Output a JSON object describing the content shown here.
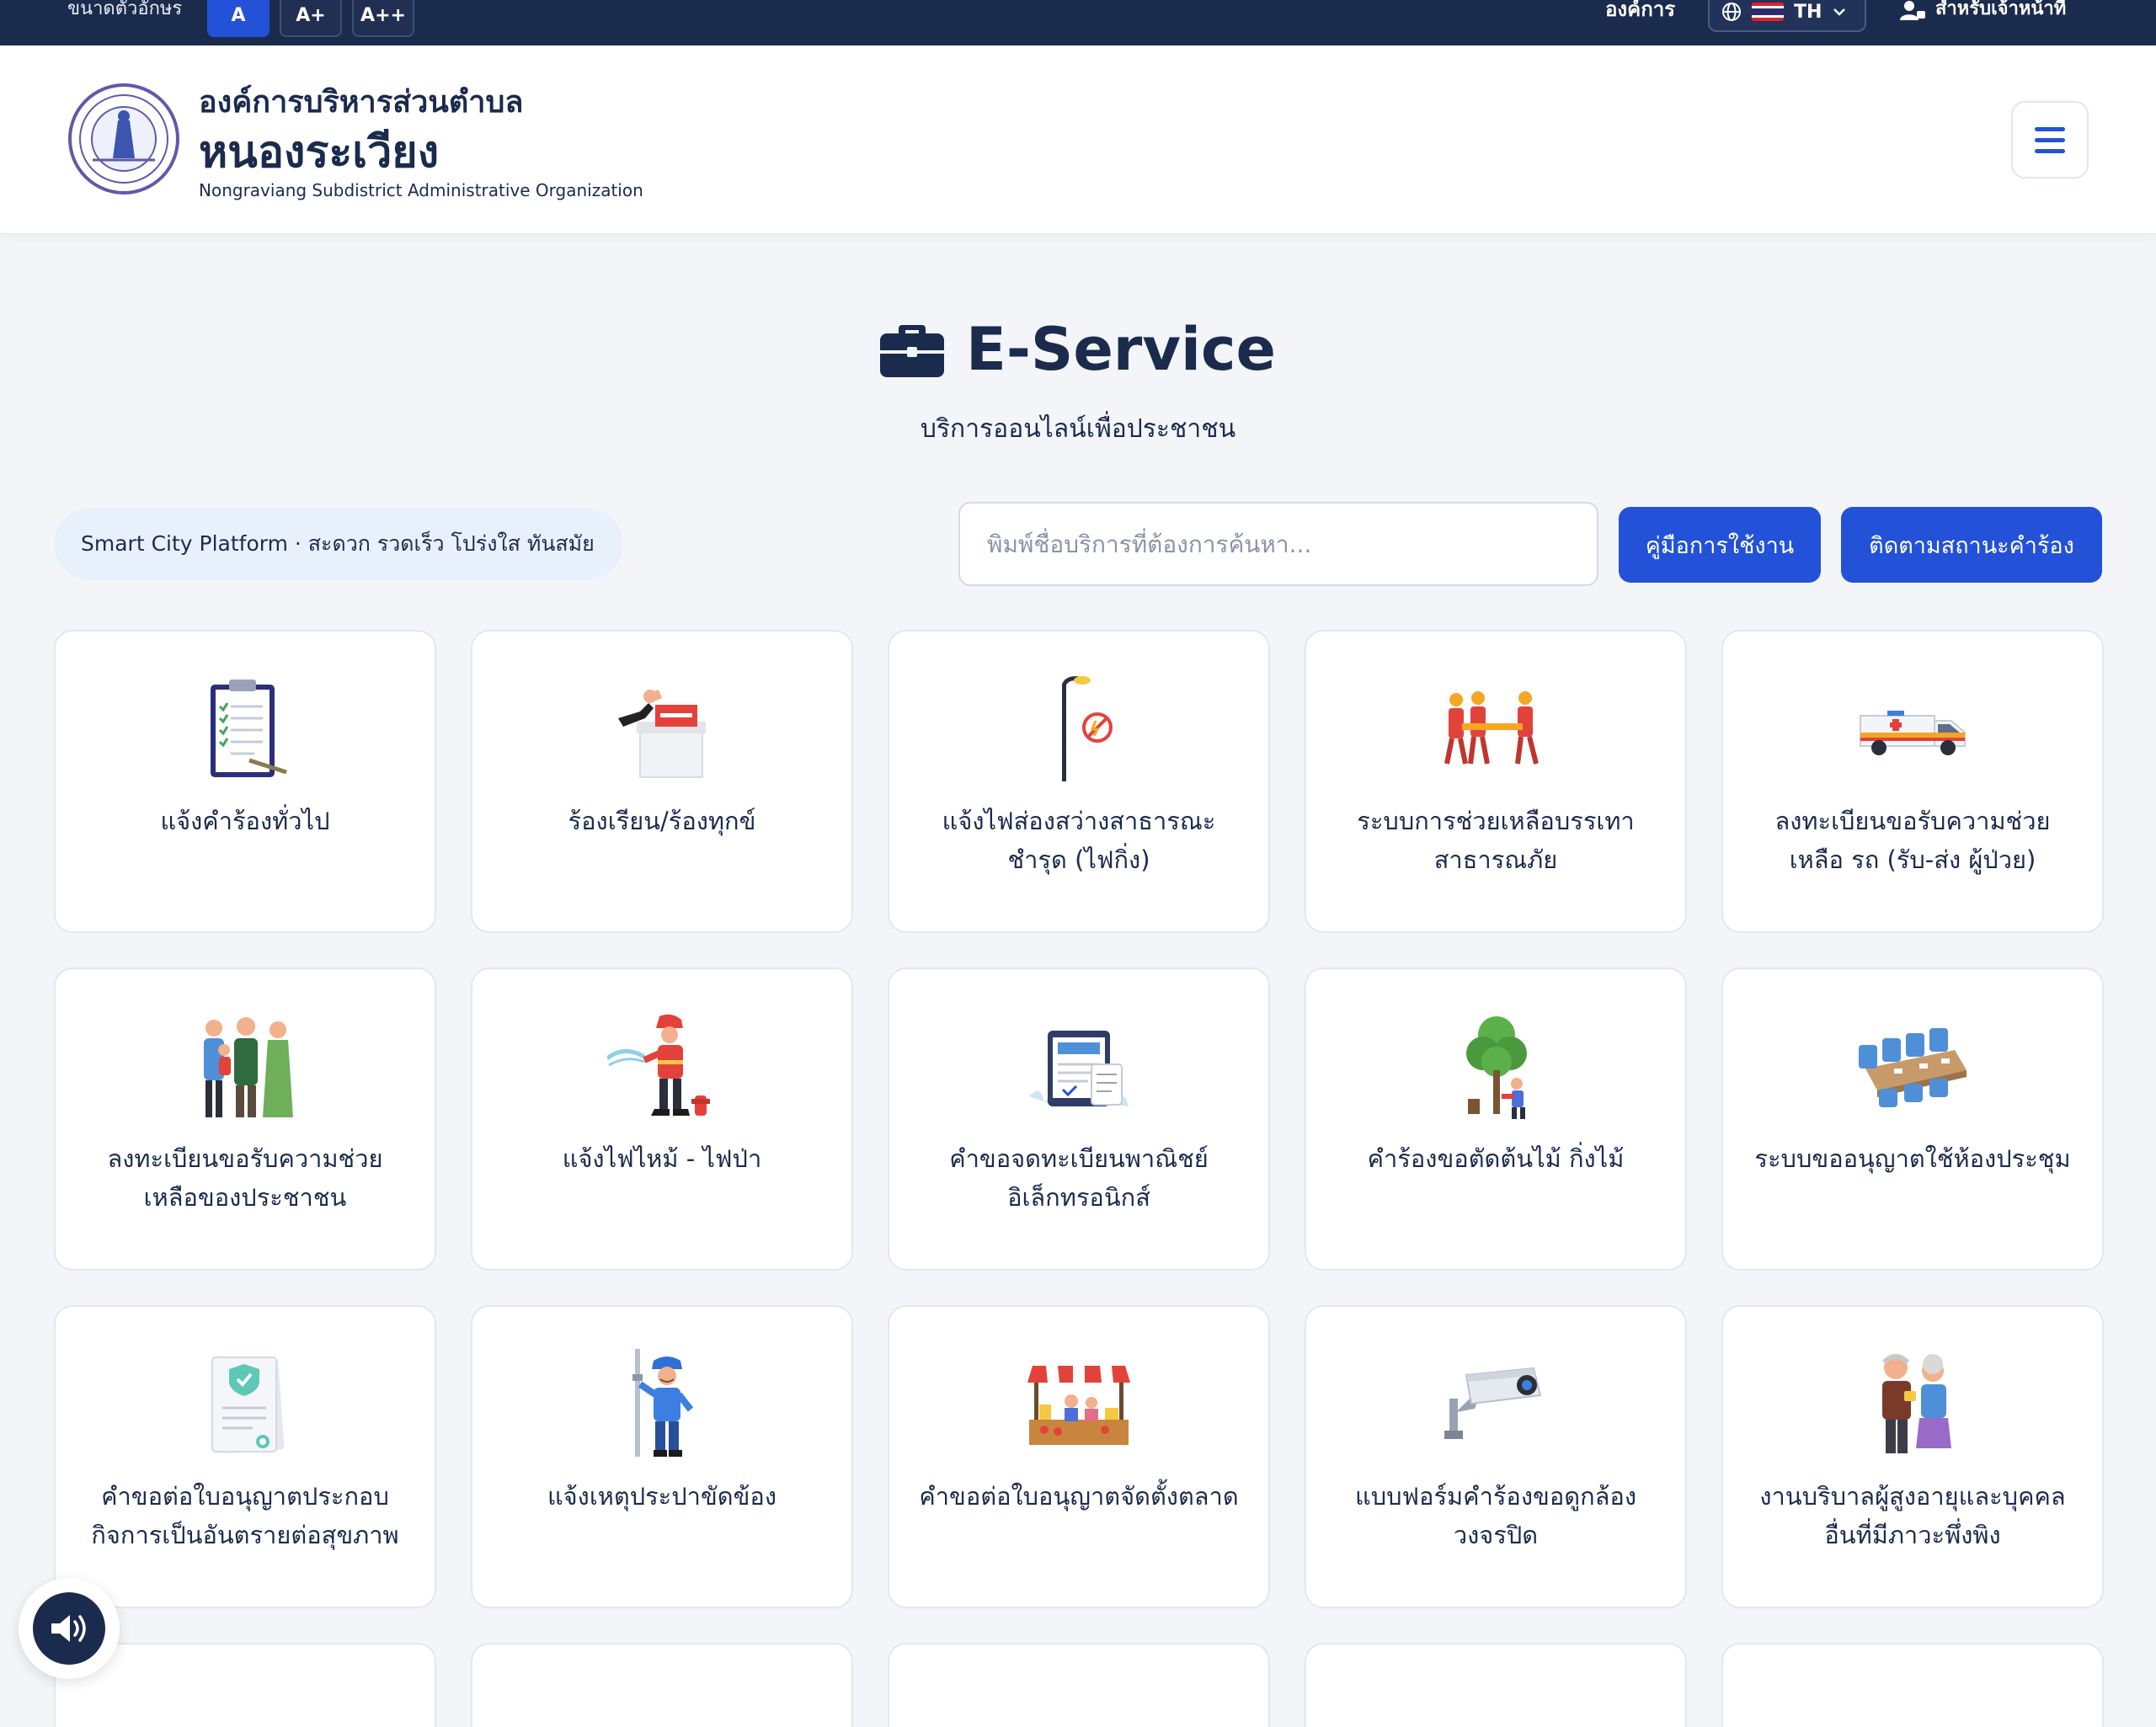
{
  "topbar": {
    "font_size_label": "ขนาดตัวอักษร",
    "font_sizes": [
      "A",
      "A+",
      "A++"
    ],
    "org_link": "องค์การ",
    "language": "TH",
    "staff_link": "สำหรับเจ้าหน้าที่"
  },
  "header": {
    "org_prefix": "องค์การบริหารส่วนตำบล",
    "org_name": "หนองระเวียง",
    "org_name_en": "Nongraviang Subdistrict Administrative Organization"
  },
  "hero": {
    "title": "E-Service",
    "subtitle": "บริการออนไลน์เพื่อประชาชน"
  },
  "toolbar": {
    "tagline": "Smart City Platform · สะดวก รวดเร็ว โปร่งใส ทันสมัย",
    "search_placeholder": "พิมพ์ชื่อบริการที่ต้องการค้นหา...",
    "manual_button": "คู่มือการใช้งาน",
    "track_button": "ติดตามสถานะคำร้อง"
  },
  "services": [
    {
      "label": "แจ้งคำร้องทั่วไป",
      "icon": "clipboard-icon"
    },
    {
      "label": "ร้องเรียน/ร้องทุกข์",
      "icon": "complaint-box-icon"
    },
    {
      "label": "แจ้งไฟส่องสว่างสาธารณะชำรุด (ไฟกิ่ง)",
      "icon": "street-lamp-icon"
    },
    {
      "label": "ระบบการช่วยเหลือบรรเทาสาธารณภัย",
      "icon": "rescue-team-icon"
    },
    {
      "label": "ลงทะเบียนขอรับความช่วยเหลือ รถ (รับ-ส่ง ผู้ป่วย)",
      "icon": "ambulance-icon"
    },
    {
      "label": "ลงทะเบียนขอรับความช่วยเหลือของประชาชน",
      "icon": "family-icon"
    },
    {
      "label": "แจ้งไฟไหม้ - ไฟป่า",
      "icon": "firefighter-icon"
    },
    {
      "label": "คำขอจดทะเบียนพาณิชย์อิเล็กทรอนิกส์",
      "icon": "e-document-icon"
    },
    {
      "label": "คำร้องขอตัดต้นไม้ กิ่งไม้",
      "icon": "tree-cutting-icon"
    },
    {
      "label": "ระบบขออนุญาตใช้ห้องประชุม",
      "icon": "meeting-room-icon"
    },
    {
      "label": "คำขอต่อใบอนุญาตประกอบกิจการเป็นอันตรายต่อสุขภาพ",
      "icon": "certificate-icon"
    },
    {
      "label": "แจ้งเหตุประปาขัดข้อง",
      "icon": "plumber-icon"
    },
    {
      "label": "คำขอต่อใบอนุญาตจัดตั้งตลาด",
      "icon": "market-stall-icon"
    },
    {
      "label": "แบบฟอร์มคำร้องขอดูกล้องวงจรปิด",
      "icon": "cctv-camera-icon"
    },
    {
      "label": "งานบริบาลผู้สูงอายุและบุคคลอื่นที่มีภาวะพึ่งพิง",
      "icon": "elderly-couple-icon"
    }
  ],
  "colors": {
    "navy": "#1b2b4d",
    "primary": "#2352d8",
    "background": "#f3f5f9"
  }
}
